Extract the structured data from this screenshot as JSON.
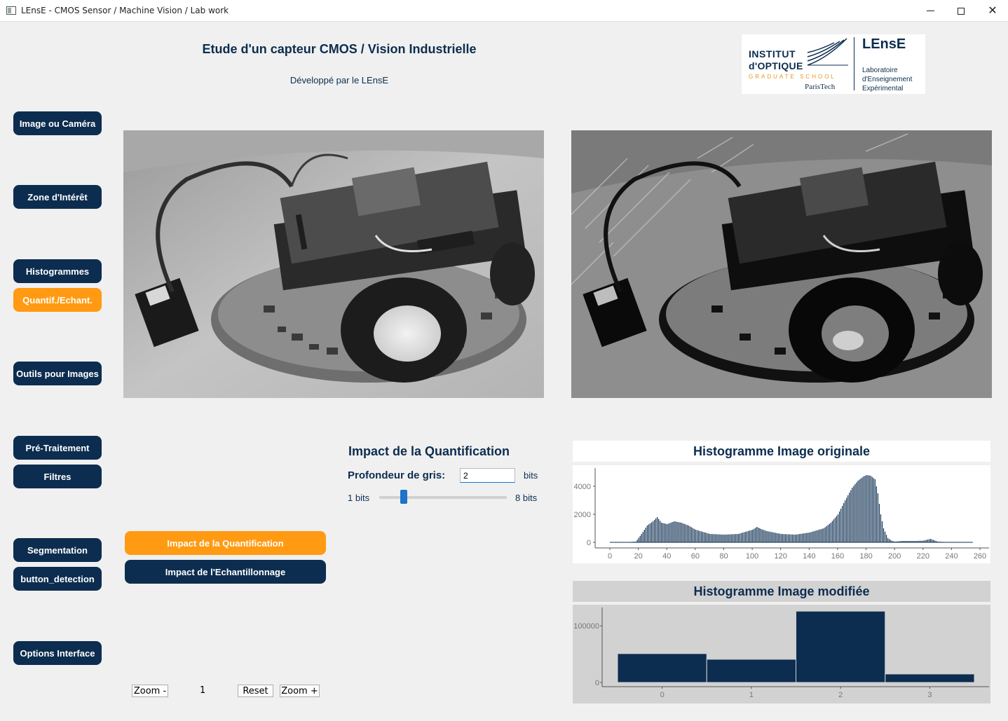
{
  "window": {
    "title": "LEnsE - CMOS Sensor / Machine Vision / Lab work"
  },
  "header": {
    "title": "Etude d'un capteur CMOS / Vision Industrielle",
    "subtitle": "Développé par le LEnsE"
  },
  "logo": {
    "institut_line1": "INSTITUT",
    "institut_line2": "d'OPTIQUE",
    "graduate": "GRADUATE SCHOOL",
    "paristech": "ParisTech",
    "lense": "LEnsE",
    "lab_line1": "Laboratoire",
    "lab_line2": "d'Enseignement",
    "lab_line3": "Expérimental"
  },
  "sidebar": {
    "items": [
      {
        "label": "Image ou Caméra",
        "active": false
      },
      {
        "label": "Zone d'Intérêt",
        "active": false
      },
      {
        "label": "Histogrammes",
        "active": false
      },
      {
        "label": "Quantif./Echant.",
        "active": true
      },
      {
        "label": "Outils pour Images",
        "active": false
      },
      {
        "label": "Pré-Traitement",
        "active": false
      },
      {
        "label": "Filtres",
        "active": false
      },
      {
        "label": "Segmentation",
        "active": false
      },
      {
        "label": "button_detection",
        "active": false
      },
      {
        "label": "Options Interface",
        "active": false
      }
    ]
  },
  "quantification": {
    "title": "Impact de la Quantification",
    "depth_label": "Profondeur de gris:",
    "depth_value": "2",
    "unit": "bits",
    "slider_min_label": "1 bits",
    "slider_max_label": "8 bits",
    "slider_min": 1,
    "slider_max": 8,
    "slider_value": 2
  },
  "actions": {
    "quantif_label": "Impact de la Quantification",
    "echant_label": "Impact de l'Echantillonnage"
  },
  "zoom": {
    "zoom_out_label": "Zoom -",
    "value": "1",
    "reset_label": "Reset",
    "zoom_in_label": "Zoom +"
  },
  "images": {
    "original": "robot-photo-grayscale",
    "modified": "robot-photo-quantized-2bits"
  },
  "colors": {
    "navy": "#0c2d4f",
    "orange": "#ff9a12",
    "slider": "#1e72c8"
  },
  "chart_data": [
    {
      "type": "bar",
      "title": "Histogramme Image originale",
      "xlim": [
        0,
        260
      ],
      "ylim": [
        0,
        5000
      ],
      "x_ticks": [
        "0",
        "20",
        "40",
        "60",
        "80",
        "100",
        "120",
        "140",
        "160",
        "180",
        "200",
        "220",
        "240",
        "260"
      ],
      "y_ticks": [
        "0",
        "2000",
        "4000"
      ],
      "x": [
        0,
        10,
        18,
        22,
        26,
        30,
        33,
        36,
        40,
        45,
        50,
        55,
        60,
        70,
        80,
        90,
        100,
        103,
        106,
        110,
        120,
        130,
        140,
        150,
        155,
        160,
        165,
        170,
        174,
        178,
        180,
        183,
        186,
        188,
        190,
        192,
        195,
        198,
        200,
        205,
        210,
        215,
        220,
        225,
        230,
        240,
        255
      ],
      "values": [
        0,
        0,
        50,
        600,
        1200,
        1500,
        1800,
        1400,
        1300,
        1500,
        1400,
        1200,
        900,
        600,
        550,
        600,
        900,
        1100,
        950,
        800,
        600,
        550,
        700,
        1000,
        1400,
        2000,
        3000,
        3900,
        4400,
        4700,
        4800,
        4750,
        4500,
        3500,
        2000,
        1000,
        300,
        100,
        50,
        100,
        100,
        100,
        120,
        250,
        50,
        0,
        0
      ]
    },
    {
      "type": "bar",
      "title": "Histogramme Image modifiée",
      "categories": [
        "0",
        "1",
        "2",
        "3"
      ],
      "values": [
        51000,
        41000,
        126000,
        15000
      ],
      "y_ticks": [
        "0",
        "100000"
      ],
      "ylim": [
        0,
        130000
      ]
    }
  ]
}
